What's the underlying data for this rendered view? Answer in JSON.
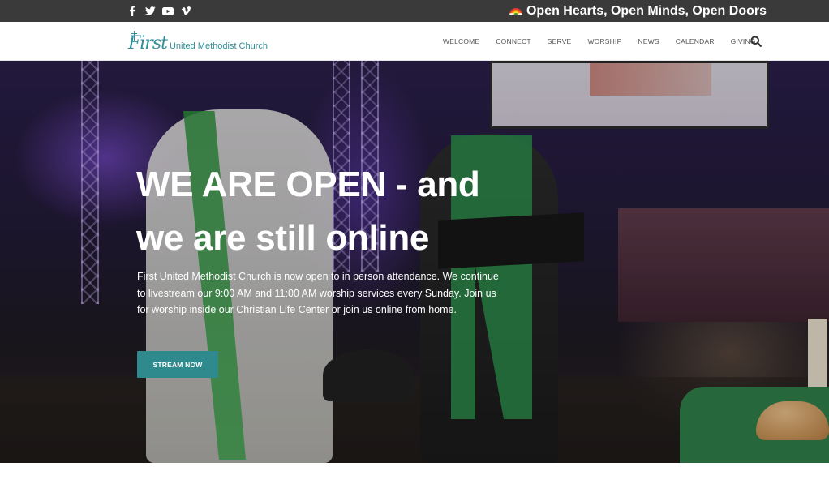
{
  "topbar": {
    "social_icons": [
      "facebook-icon",
      "twitter-icon",
      "youtube-icon",
      "vimeo-icon"
    ],
    "tagline": "Open Hearts, Open Minds, Open Doors",
    "tagline_icon": "rainbow-icon"
  },
  "header": {
    "logo_first": "First",
    "logo_text": "United Methodist Church",
    "nav": [
      "WELCOME",
      "CONNECT",
      "SERVE",
      "WORSHIP",
      "NEWS",
      "CALENDAR",
      "GIVING"
    ],
    "search_icon": "search-icon"
  },
  "hero": {
    "headline_line1": "WE ARE OPEN - and",
    "headline_line2": "we are still online",
    "description": "First United Methodist Church is now open to in person attendance. We continue to livestream our 9:00 AM and 11:00 AM worship services every Sunday. Join us for worship inside our Christian Life Center or join us online from home.",
    "button_label": "STREAM NOW"
  },
  "colors": {
    "topbar_bg": "#3a3a3a",
    "brand_teal": "#2f8f98",
    "button_bg": "#2e8a8c"
  }
}
